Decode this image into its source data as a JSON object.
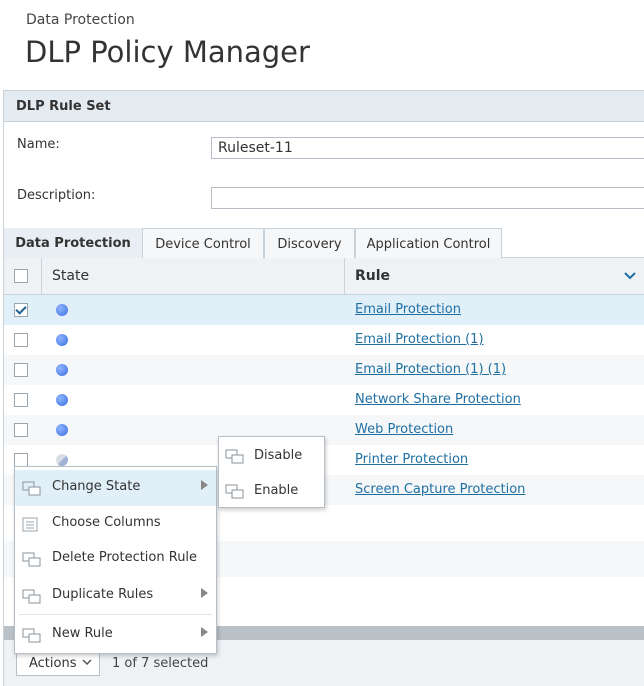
{
  "breadcrumb": "Data Protection",
  "title": "DLP Policy Manager",
  "panel": {
    "header": "DLP Rule Set",
    "name_label": "Name:",
    "name_value": "Ruleset-11",
    "description_label": "Description:",
    "description_value": ""
  },
  "tabs": [
    "Data Protection",
    "Device Control",
    "Discovery",
    "Application Control"
  ],
  "grid": {
    "columns": {
      "state": "State",
      "rule": "Rule"
    },
    "rows": [
      {
        "rule": "Email Protection",
        "checked": true,
        "state": "enabled"
      },
      {
        "rule": "Email Protection (1)",
        "checked": false,
        "state": "enabled"
      },
      {
        "rule": "Email Protection (1) (1)",
        "checked": false,
        "state": "enabled"
      },
      {
        "rule": "Network Share Protection",
        "checked": false,
        "state": "enabled"
      },
      {
        "rule": "Web Protection",
        "checked": false,
        "state": "enabled"
      },
      {
        "rule": "Printer Protection",
        "checked": false,
        "state": "partial"
      },
      {
        "rule": "Screen Capture Protection",
        "checked": false,
        "state": "enabled"
      }
    ]
  },
  "footer": {
    "actions_label": "Actions",
    "selection": "1 of 7 selected"
  },
  "context_menu": {
    "items": [
      "Change State",
      "Choose Columns",
      "Delete Protection Rule",
      "Duplicate Rules",
      "New Rule"
    ]
  },
  "submenu": {
    "items": [
      "Disable",
      "Enable"
    ]
  },
  "colors": {
    "link": "#1f6fa3",
    "selected_row": "#e1eff9",
    "header_bg": "#e3eaf0"
  }
}
